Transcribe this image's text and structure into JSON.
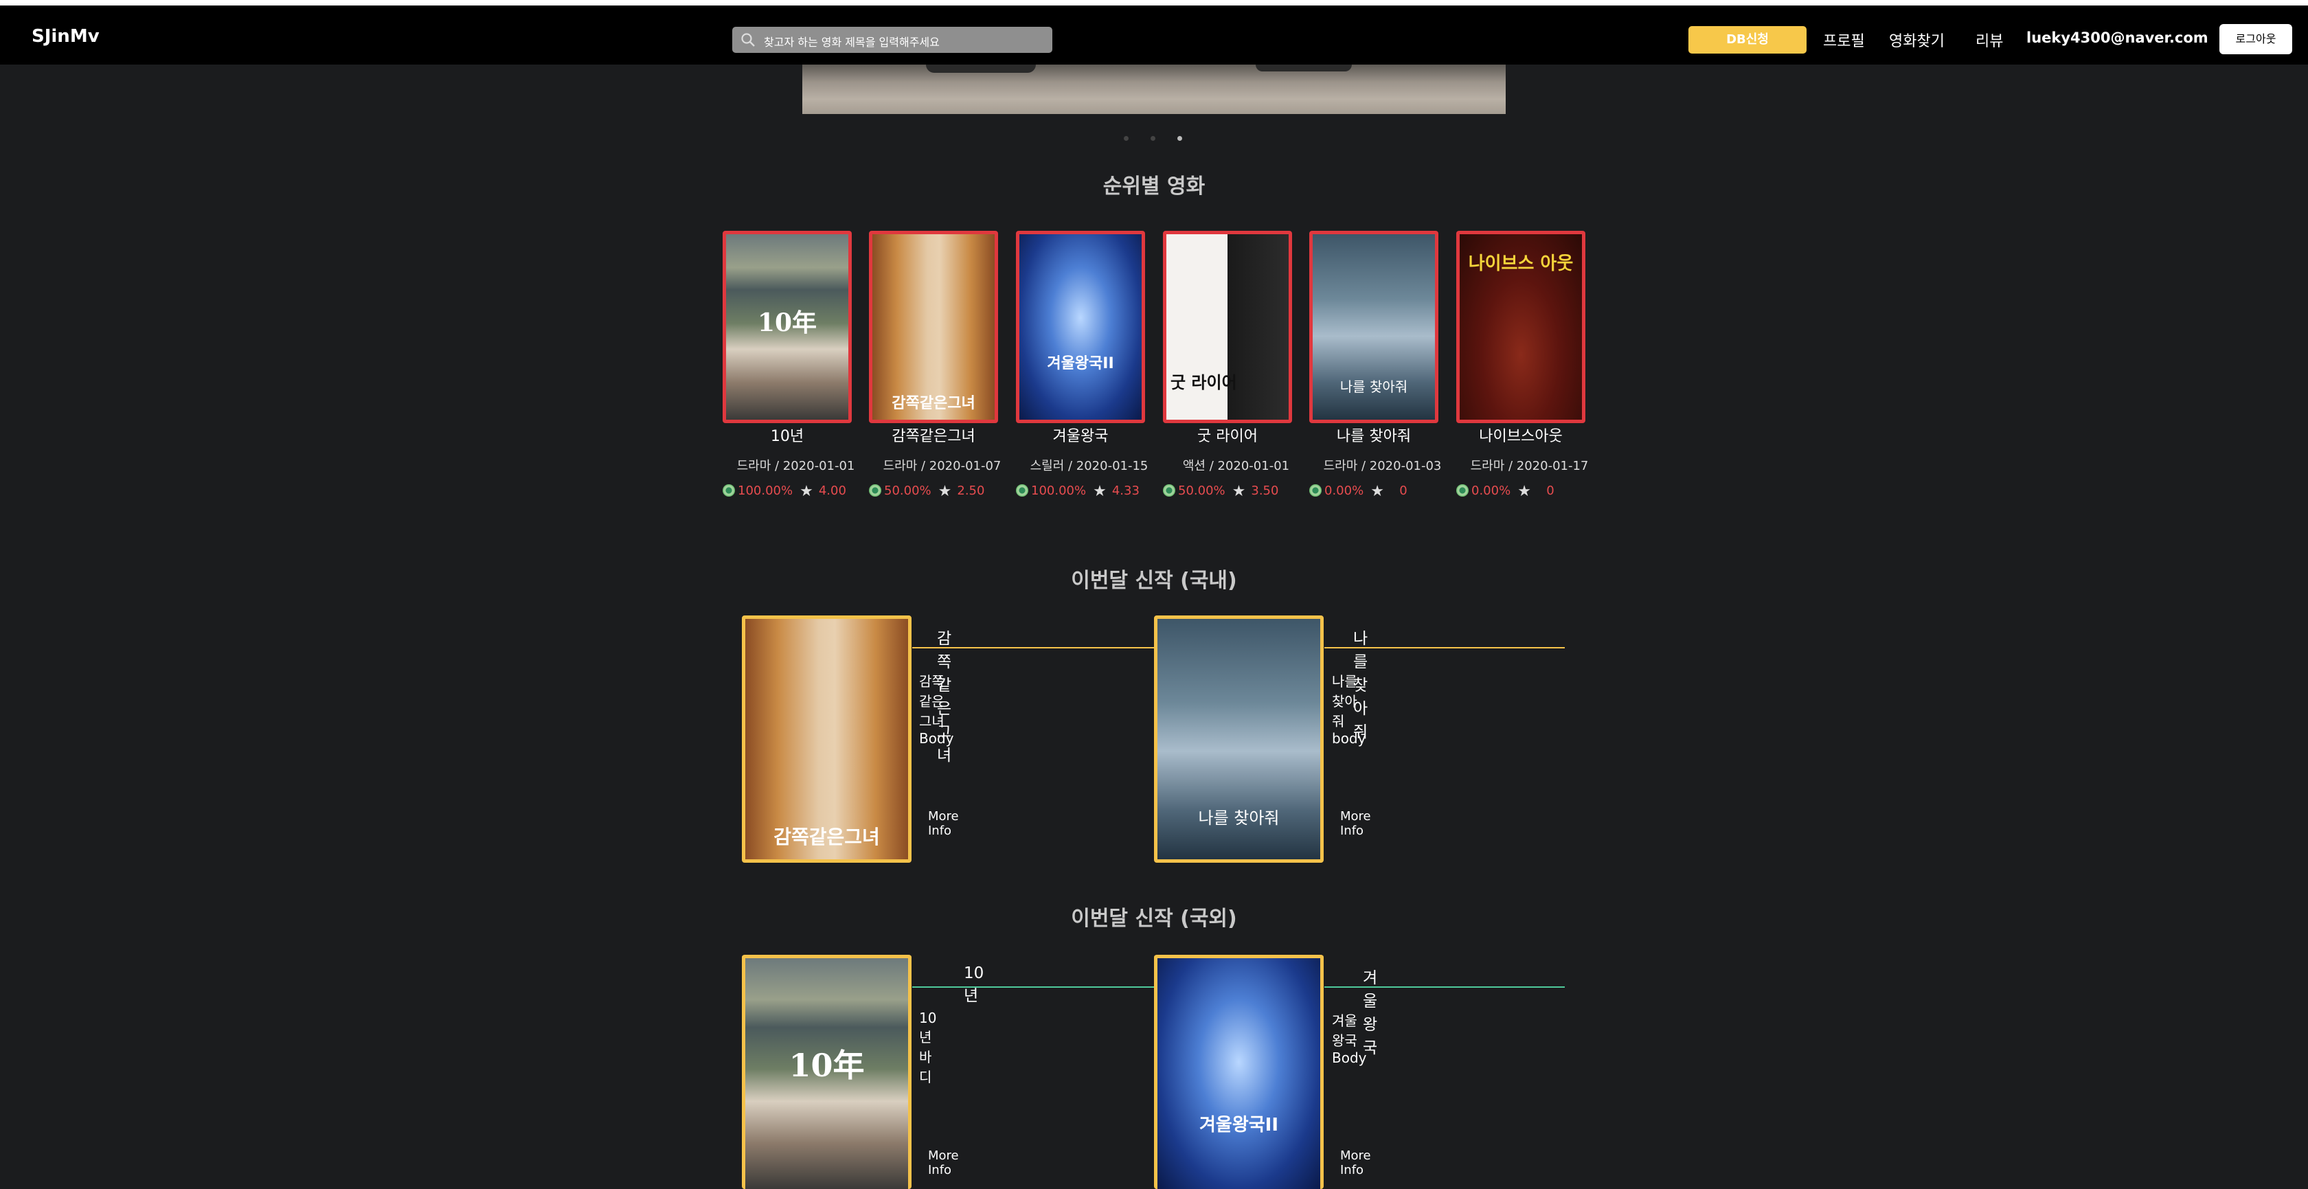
{
  "navbar": {
    "brand": "SJinMv",
    "search_placeholder": "찾고자 하는 영화 제목을 입력해주세요",
    "db_button": "DB신청",
    "links": [
      "프로필",
      "영화찾기",
      "리뷰"
    ],
    "user_email": "lueky4300@naver.com",
    "logout_button": "로그아웃"
  },
  "carousel": {
    "slide_count": 3,
    "active_index": 2
  },
  "ranking": {
    "title": "순위별 영화",
    "movies": [
      {
        "title": "10년",
        "meta": "드라마 / 2020-01-01",
        "percent": "100.00%",
        "score": "4.00",
        "poster_text": "10年"
      },
      {
        "title": "감쪽같은그녀",
        "meta": "드라마 / 2020-01-07",
        "percent": "50.00%",
        "score": "2.50",
        "poster_text": "감쪽같은그녀"
      },
      {
        "title": "겨울왕국",
        "meta": "스릴러 / 2020-01-15",
        "percent": "100.00%",
        "score": "4.33",
        "poster_text": "겨울왕국II"
      },
      {
        "title": "굿 라이어",
        "meta": "액션 / 2020-01-01",
        "percent": "50.00%",
        "score": "3.50",
        "poster_text": "굿 라이어"
      },
      {
        "title": "나를 찾아줘",
        "meta": "드라마 / 2020-01-03",
        "percent": "0.00%",
        "score": "0",
        "poster_text": "나를 찾아줘"
      },
      {
        "title": "나이브스아웃",
        "meta": "드라마 / 2020-01-17",
        "percent": "0.00%",
        "score": "0",
        "poster_text": "나이브스 아웃"
      }
    ]
  },
  "domestic": {
    "title": "이번달 신작 (국내)",
    "movies": [
      {
        "title": "감쪽같은그녀",
        "body": "감쪽같은그녀 Body",
        "more": "More Info",
        "poster_text": "감쪽같은그녀"
      },
      {
        "title": "나를 찾아줘",
        "body": "나를 찾아줘body",
        "more": "More Info",
        "poster_text": "나를 찾아줘"
      }
    ]
  },
  "foreign": {
    "title": "이번달 신작 (국외)",
    "movies": [
      {
        "title": "10년",
        "body": "10년 바디",
        "more": "More Info",
        "poster_text": "10年"
      },
      {
        "title": "겨울왕국",
        "body": "겨울왕국Body",
        "more": "More Info",
        "poster_text": "겨울왕국II"
      }
    ]
  },
  "colors": {
    "accent_yellow": "#f7c84a",
    "rank_border": "#e0383e",
    "domestic_line": "#f5c24a",
    "foreign_line": "#4fc99a",
    "rate_text": "#e74c4f"
  }
}
